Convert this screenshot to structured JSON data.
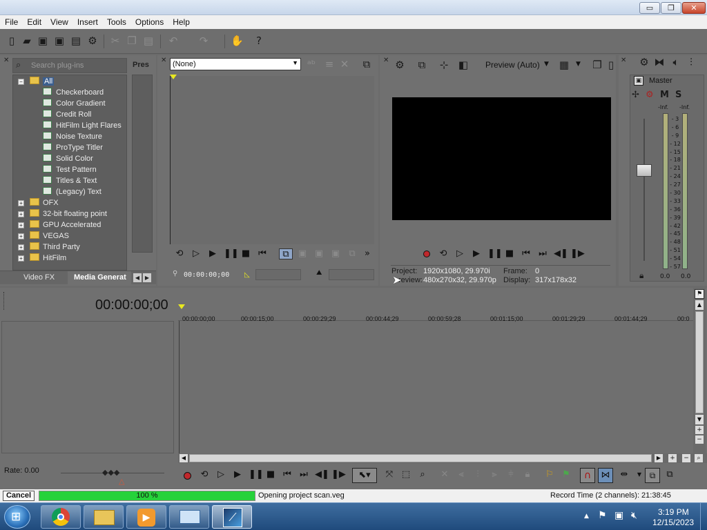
{
  "menu": [
    "File",
    "Edit",
    "View",
    "Insert",
    "Tools",
    "Options",
    "Help"
  ],
  "window_buttons": {
    "minimize": "▭",
    "restore": "❐",
    "close": "✕"
  },
  "explorer": {
    "search_placeholder": "Search plug-ins",
    "presets_header": "Pres",
    "root": "All",
    "items": [
      "Checkerboard",
      "Color Gradient",
      "Credit Roll",
      "HitFilm Light Flares",
      "Noise Texture",
      "ProType Titler",
      "Solid Color",
      "Test Pattern",
      "Titles & Text",
      "(Legacy) Text"
    ],
    "folders": [
      "OFX",
      "32-bit floating point",
      "GPU Accelerated",
      "VEGAS",
      "Third Party",
      "HitFilm"
    ],
    "tabs": [
      "Video FX",
      "Media Generat"
    ]
  },
  "trimmer": {
    "selection": "(None)",
    "timecode": "00:00:00;00"
  },
  "preview": {
    "mode_label": "Preview (Auto)",
    "project_label": "Project:",
    "project_value": "1920x1080, 29.970i",
    "frame_label": "Frame:",
    "frame_value": "0",
    "preview_label": "review:",
    "preview_value": "480x270x32, 29.970p",
    "display_label": "Display:",
    "display_value": "317x178x32"
  },
  "mixer": {
    "title": "Master",
    "m_label": "M",
    "s_label": "S",
    "inf_left": "-Inf.",
    "inf_right": "-Inf.",
    "scale": [
      "3",
      "6",
      "9",
      "12",
      "15",
      "18",
      "21",
      "24",
      "27",
      "30",
      "33",
      "36",
      "39",
      "42",
      "45",
      "48",
      "51",
      "54",
      "57"
    ],
    "left_value": "0.0",
    "right_value": "0.0"
  },
  "timeline": {
    "timecode": "00:00:00;00",
    "ruler": [
      "00:00:00;00",
      "00:00:15;00",
      "00:00:29;29",
      "00:00:44;29",
      "00:00:59;28",
      "00:01:15;00",
      "00:01:29;29",
      "00:01:44;29",
      "00:0"
    ],
    "rate_label": "Rate: 0.00"
  },
  "status": {
    "cancel_label": "Cancel",
    "progress_percent": 100,
    "progress_text": "100 %",
    "message": "Opening project scan.veg",
    "record_time": "Record Time (2 channels): 21:38:45"
  },
  "taskbar": {
    "time": "3:19 PM",
    "date": "12/15/2023"
  },
  "colors": {
    "progress_green": "#26d23a",
    "panel_gray": "#707070",
    "preview_black": "#000000",
    "taskbar_blue": "#1f4a7c"
  }
}
